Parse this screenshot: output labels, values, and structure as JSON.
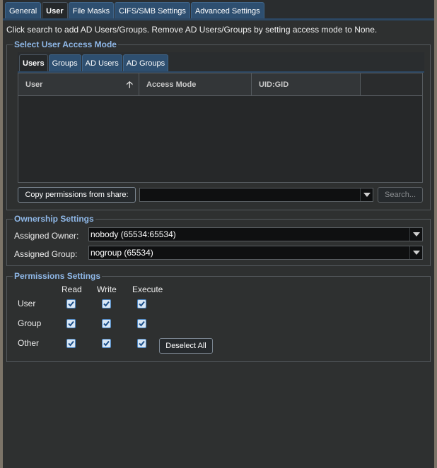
{
  "tabs": [
    {
      "label": "General",
      "active": false
    },
    {
      "label": "User",
      "active": true
    },
    {
      "label": "File Masks",
      "active": false
    },
    {
      "label": "CIFS/SMB Settings",
      "active": false
    },
    {
      "label": "Advanced Settings",
      "active": false
    }
  ],
  "info_text": "Click search to add AD Users/Groups. Remove AD Users/Groups by setting access mode to None.",
  "access_mode": {
    "legend": "Select User Access Mode",
    "subtabs": [
      {
        "label": "Users",
        "active": true
      },
      {
        "label": "Groups",
        "active": false
      },
      {
        "label": "AD Users",
        "active": false
      },
      {
        "label": "AD Groups",
        "active": false
      }
    ],
    "columns": {
      "user": "User",
      "access_mode": "Access Mode",
      "uid_gid": "UID:GID"
    },
    "sort_icon": "arrow-up-icon",
    "rows": [],
    "copy_button": "Copy permissions from share:",
    "share_value": "",
    "search_button": "Search..."
  },
  "ownership": {
    "legend": "Ownership Settings",
    "owner_label": "Assigned Owner:",
    "owner_value": "nobody (65534:65534)",
    "group_label": "Assigned Group:",
    "group_value": "nogroup (65534)"
  },
  "permissions": {
    "legend": "Permissions Settings",
    "headers": {
      "read": "Read",
      "write": "Write",
      "execute": "Execute"
    },
    "rows": [
      {
        "label": "User",
        "read": true,
        "write": true,
        "execute": true
      },
      {
        "label": "Group",
        "read": true,
        "write": true,
        "execute": true
      },
      {
        "label": "Other",
        "read": true,
        "write": true,
        "execute": true
      }
    ],
    "deselect_button": "Deselect All"
  },
  "colors": {
    "accent": "#2e4f70",
    "legend": "#8fb8e8",
    "checkbox": "#4b86c4"
  }
}
